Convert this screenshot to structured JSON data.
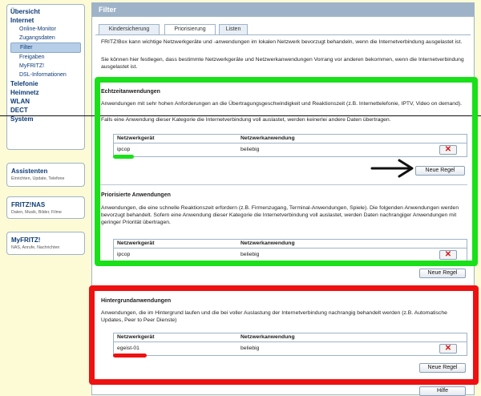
{
  "sidebar": {
    "items": [
      {
        "label": "Übersicht",
        "level": "top"
      },
      {
        "label": "Internet",
        "level": "top"
      },
      {
        "label": "Online-Monitor",
        "level": "sub"
      },
      {
        "label": "Zugangsdaten",
        "level": "sub"
      },
      {
        "label": "Filter",
        "level": "sub",
        "active": true
      },
      {
        "label": "Freigaben",
        "level": "sub"
      },
      {
        "label": "MyFRITZ!",
        "level": "sub"
      },
      {
        "label": "DSL-Informationen",
        "level": "sub"
      },
      {
        "label": "Telefonie",
        "level": "top"
      },
      {
        "label": "Heimnetz",
        "level": "top"
      },
      {
        "label": "WLAN",
        "level": "top"
      },
      {
        "label": "DECT",
        "level": "top"
      },
      {
        "label": "System",
        "level": "top"
      }
    ],
    "cards": [
      {
        "title": "Assistenten",
        "subtitle": "Einrichten, Update, Telefone"
      },
      {
        "title": "FRITZ!NAS",
        "subtitle": "Daten, Musik, Bilder, Filme"
      },
      {
        "title": "MyFRITZ!",
        "subtitle": "NAS, Anrufe, Nachrichten"
      }
    ]
  },
  "panel": {
    "title": "Filter",
    "tabs": [
      "Kindersicherung",
      "Priorisierung",
      "Listen"
    ],
    "active_tab": "Priorisierung",
    "intro": [
      "FRITZ!Box kann wichtige Netzwerkgeräte und -anwendungen im lokalen Netzwerk bevorzugt behandeln, wenn die Internetverbindung ausgelastet ist.",
      "Sie können hier festlegen, dass bestimmte Netzwerkgeräte und Netzwerkanwendungen Vorrang vor anderen bekommen, wenn die Internetverbindung ausgelastet ist."
    ],
    "columns": {
      "device": "Netzwerkgerät",
      "app": "Netzwerkanwendung"
    },
    "sections": [
      {
        "title": "Echtzeitanwendungen",
        "description": "Anwendungen mit sehr hohen Anforderungen an die Übertragungsgeschwindigkeit und Reaktionszeit (z.B. Internettelefonie, IPTV, Video on demand).",
        "description2": "Falls eine Anwendung dieser Kategorie die Internetverbindung voll auslastet, werden keinerlei andere Daten übertragen.",
        "rows": [
          {
            "device": "ipcop",
            "app": "beliebig"
          }
        ],
        "button": "Neue Regel"
      },
      {
        "title": "Priorisierte Anwendungen",
        "description": "Anwendungen, die eine schnelle Reaktionszeit erfordern (z.B. Firmenzugang, Terminal-Anwendungen, Spiele). Die folgenden Anwendungen werden bevorzugt behandelt. Sofern eine Anwendung dieser Kategorie die Internetverbindung voll auslastet, werden Daten nachrangiger Anwendungen mit geringer Priorität übertragen.",
        "rows": [
          {
            "device": "ipcop",
            "app": "beliebig"
          }
        ],
        "button": "Neue Regel"
      },
      {
        "title": "Hintergrundanwendungen",
        "description": "Anwendungen, die im Hintergrund laufen und die bei voller Auslastung der Internetverbindung nachrangig behandelt werden (z.B. Automatische Updates, Peer to Peer Dienste)",
        "rows": [
          {
            "device": "egeist-01",
            "app": "beliebig"
          }
        ],
        "button": "Neue Regel"
      }
    ],
    "delete_icon": "✕",
    "help_button": "Hilfe"
  },
  "annotation_colors": {
    "green": "#19e019",
    "red": "#ee1111",
    "arrow": "#111111"
  }
}
